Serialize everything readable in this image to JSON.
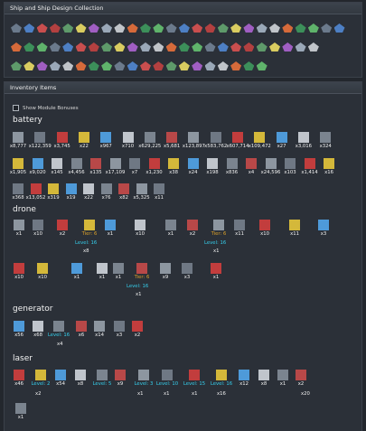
{
  "ships_panel": {
    "title": "Ship and Ship Design Collection"
  },
  "inventory_panel": {
    "title": "Inventory Items",
    "toggle_label": "Show Module Bonuses"
  },
  "categories": {
    "battery": "battery",
    "drone": "drone",
    "generator": "generator",
    "laser": "laser"
  },
  "battery": {
    "row1": [
      "x8,777",
      "x122,359",
      "x3,745",
      "x22",
      "x967",
      "x710",
      "x629,225",
      "x5,681",
      "x123,897",
      "x583,762",
      "x607,714",
      "x109,472",
      "x27",
      "x3,016",
      "x324"
    ],
    "row2": [
      "x1,905",
      "x9,020",
      "x145",
      "x4,456",
      "x135",
      "x17,109",
      "x7",
      "x1,230",
      "x38",
      "x24",
      "x198",
      "x836",
      "x4",
      "x24,596",
      "x103",
      "x1,414",
      "x16"
    ],
    "row3": [
      "x368",
      "x13,052",
      "x319",
      "x19",
      "x22",
      "x76",
      "x82",
      "x5,325",
      "x11"
    ]
  },
  "drone": {
    "row1": [
      "x1",
      "x10",
      "x2",
      "Tier: 6",
      "x1",
      "x10",
      "x1",
      "x2",
      "Tier: 6",
      "x11",
      "x10",
      "x11",
      "x3"
    ],
    "row1_level": "Level: 16",
    "row1_level_count": "x8",
    "row1_level2": "Level: 16",
    "row1_level2_count": "x1",
    "row2": [
      "x10",
      "x10",
      "x1",
      "x1",
      "x1",
      "Tier: 6",
      "x9",
      "x3",
      "x1"
    ],
    "row2_level": "Level: 16",
    "row2_level_count": "x1"
  },
  "generator": {
    "row1": [
      "x56",
      "x68",
      "Level: 16",
      "x6",
      "x14",
      "x3",
      "x2"
    ],
    "row1_count": "x4"
  },
  "laser": {
    "row1": [
      "x46",
      "Level: 2",
      "x54",
      "x8",
      "Level: 5",
      "x9",
      "Level: 3",
      "Level: 10",
      "Level: 15",
      "Level: 16",
      "x12",
      "x8",
      "x1",
      "x2"
    ],
    "row1_sub": [
      "x2",
      "x1",
      "x1",
      "x1",
      "x16",
      "x20"
    ],
    "row2": [
      "x1"
    ]
  },
  "colors": {
    "level": "#35d0ee",
    "tier": "#e0a328",
    "panel": "#2b3038"
  }
}
